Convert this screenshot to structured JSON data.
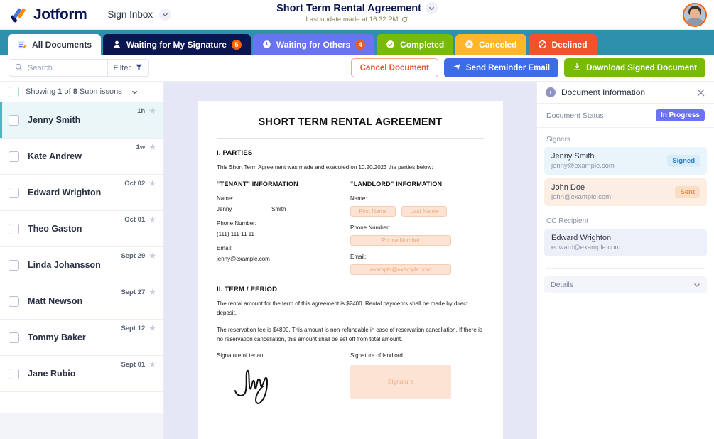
{
  "header": {
    "brand_name": "Jotform",
    "logo_icon": "jotform-logo-icon",
    "inbox_label": "Sign Inbox",
    "inbox_chevron_icon": "chevron-down-icon",
    "doc_title": "Short Term Rental Agreement",
    "doc_title_chevron_icon": "chevron-down-icon",
    "last_update": "Last update made at 16:32 PM",
    "refresh_icon": "refresh-icon",
    "avatar_icon": "user-avatar"
  },
  "tabs": [
    {
      "label": "All Documents",
      "icon": "documents-icon",
      "badge": "",
      "style": "active-white"
    },
    {
      "label": "Waiting for My Signature",
      "icon": "person-icon",
      "badge": "5",
      "style": "t-wait-sig"
    },
    {
      "label": "Waiting for Others",
      "icon": "clock-icon",
      "badge": "4",
      "style": "t-wait-oth"
    },
    {
      "label": "Completed",
      "icon": "check-circle-icon",
      "badge": "",
      "style": "t-completed"
    },
    {
      "label": "Canceled",
      "icon": "x-circle-icon",
      "badge": "",
      "style": "t-canceled"
    },
    {
      "label": "Declined",
      "icon": "ban-icon",
      "badge": "",
      "style": "t-declined"
    }
  ],
  "toolbar": {
    "search_placeholder": "Search",
    "search_value": "",
    "search_icon": "search-icon",
    "filter_label": "Filter",
    "filter_icon": "funnel-icon",
    "cancel_label": "Cancel Document",
    "remind_label": "Send Reminder Email",
    "remind_icon": "send-icon",
    "download_label": "Download Signed Document",
    "download_icon": "download-icon"
  },
  "list": {
    "header_prefix": "Showing ",
    "header_count": "1",
    "header_mid": " of ",
    "header_total": "8",
    "header_suffix": " Submissons",
    "header_chevron_icon": "chevron-down-icon",
    "rows": [
      {
        "name": "Jenny Smith",
        "date": "1h",
        "selected": true
      },
      {
        "name": "Kate Andrew",
        "date": "1w",
        "selected": false
      },
      {
        "name": "Edward Wrighton",
        "date": "Oct 02",
        "selected": false
      },
      {
        "name": "Theo Gaston",
        "date": "Oct 01",
        "selected": false
      },
      {
        "name": "Linda Johansson",
        "date": "Sept 29",
        "selected": false
      },
      {
        "name": "Matt Newson",
        "date": "Sept 27",
        "selected": false
      },
      {
        "name": "Tommy Baker",
        "date": "Sept 12",
        "selected": false
      },
      {
        "name": "Jane Rubio",
        "date": "Sept 01",
        "selected": false
      }
    ]
  },
  "document": {
    "title": "SHORT TERM RENTAL AGREEMENT",
    "section1_heading": "I. PARTIES",
    "section1_intro": "This Short Term Agreement was made and executed on 10.20.2023 the parties below:",
    "tenant": {
      "heading": "“TENANT” INFORMATION",
      "name_label": "Name:",
      "first_name": "Jenny",
      "last_name": "Smith",
      "phone_label": "Phone Number:",
      "phone": "(111) 111 11 11",
      "email_label": "Email:",
      "email": "jenny@example.com"
    },
    "landlord": {
      "heading": "“LANDLORD” INFORMATION",
      "name_label": "Name:",
      "first_name_ph": "First Name",
      "last_name_ph": "Last Name",
      "phone_label": "Phone Number:",
      "phone_ph": "Phone Number",
      "email_label": "Email:",
      "email_ph": "example@example.com"
    },
    "section2_heading": "II. TERM / PERIOD",
    "section2_p1": "The rental amount for the term of this agreement is $2400. Rental payments shall be made by direct deposit.",
    "section2_p2": "The reservation fee is $4800. This amount is non-refundable in case of reservation cancellation. If there is no reservation cancellation, this amount shall be set off from total amount.",
    "tenant_sig_label": "Signature of tenant",
    "landlord_sig_label": "Signature of landlord",
    "landlord_sig_ph": "Signature",
    "tenant_sig_icon": "handwritten-signature"
  },
  "info_panel": {
    "title": "Document Information",
    "info_icon": "info-icon",
    "close_icon": "close-icon",
    "status_label": "Document Status",
    "status_value": "In Progress",
    "signers_label": "Signers",
    "signers": [
      {
        "name": "Jenny Smith",
        "email": "jenny@example.com",
        "status": "Signed",
        "style": "signed"
      },
      {
        "name": "John Doe",
        "email": "john@example.com",
        "status": "Sent",
        "style": "sent"
      }
    ],
    "cc_label": "CC Recipient",
    "cc": [
      {
        "name": "Edward Wrighton",
        "email": "edward@example.com",
        "status": "",
        "style": "cc"
      }
    ],
    "details_label": "Details",
    "details_chevron_icon": "chevron-down-icon"
  },
  "colors": {
    "brand_navy": "#0a1551",
    "tabbar_teal": "#2f90ad",
    "accent_orange": "#ff6100",
    "indigo": "#6c73f2",
    "green": "#78bb07",
    "amber": "#ffb629",
    "red": "#f4512c",
    "blue_button": "#3d6ce7",
    "viewer_bg": "#e5e6f6",
    "selected_row": "#eaf6f7",
    "fill_peach": "#fce3d3"
  }
}
